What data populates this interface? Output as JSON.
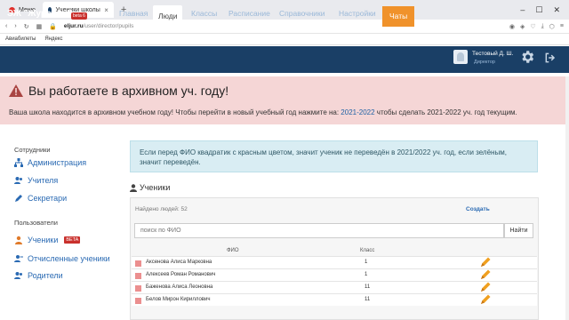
{
  "browser": {
    "tab1_label": "Меню",
    "tab2_label": "Ученики школы | Eljur.ru",
    "url_domain": "eljur.ru",
    "url_path": "/user/director/pupils",
    "bookmark1": "Авиабилеты",
    "bookmark2": "Яндекс"
  },
  "navbar": {
    "brand": "ЭЖ \"Журавль\"",
    "brand_badge": "beta 6",
    "items": [
      {
        "label": "Главная"
      },
      {
        "label": "Люди"
      },
      {
        "label": "Классы"
      },
      {
        "label": "Расписание"
      },
      {
        "label": "Справочники"
      },
      {
        "label": "Настройки"
      },
      {
        "label": "Чаты"
      }
    ],
    "user_name": "Тестовый Д. Ш.",
    "user_role": "Директор"
  },
  "alert": {
    "title": "Вы работаете в архивном уч. году!",
    "text_before": "Ваша школа находится в архивном учебном году! Чтобы перейти в новый учебный год нажмите на: ",
    "link": "2021-2022",
    "text_after": " чтобы сделать 2021-2022 уч. год текущим."
  },
  "sidebar": {
    "section1": "Сотрудники",
    "section1_items": [
      "Администрация",
      "Учителя",
      "Секретари"
    ],
    "section2": "Пользователи",
    "section2_items": [
      "Ученики",
      "Отчисленные ученики",
      "Родители"
    ],
    "beta_label": "BETA"
  },
  "main": {
    "info": "Если перед ФИО квадратик с красным цветом, значит ученик не переведён в 2021/2022 уч. год, если зелёным, значит переведён.",
    "heading": "Ученики",
    "found": "Найдено людей: 52",
    "create": "Создать",
    "search_placeholder": "поиск по ФИО",
    "search_button": "Найти",
    "col_fio": "ФИО",
    "col_class": "Класс",
    "rows": [
      {
        "name": "Аксенова Алиса Марковна",
        "class": "1"
      },
      {
        "name": "Алексеев Роман Романович",
        "class": "1"
      },
      {
        "name": "Баженова Алиса Леоновна",
        "class": "11"
      },
      {
        "name": "Белов Мирон Кириллович",
        "class": "11"
      }
    ]
  },
  "colors": {
    "navbar": "#1a3f66",
    "alert_bg": "#f5d6d6",
    "accent": "#f0922b",
    "link": "#2a6ab3"
  }
}
